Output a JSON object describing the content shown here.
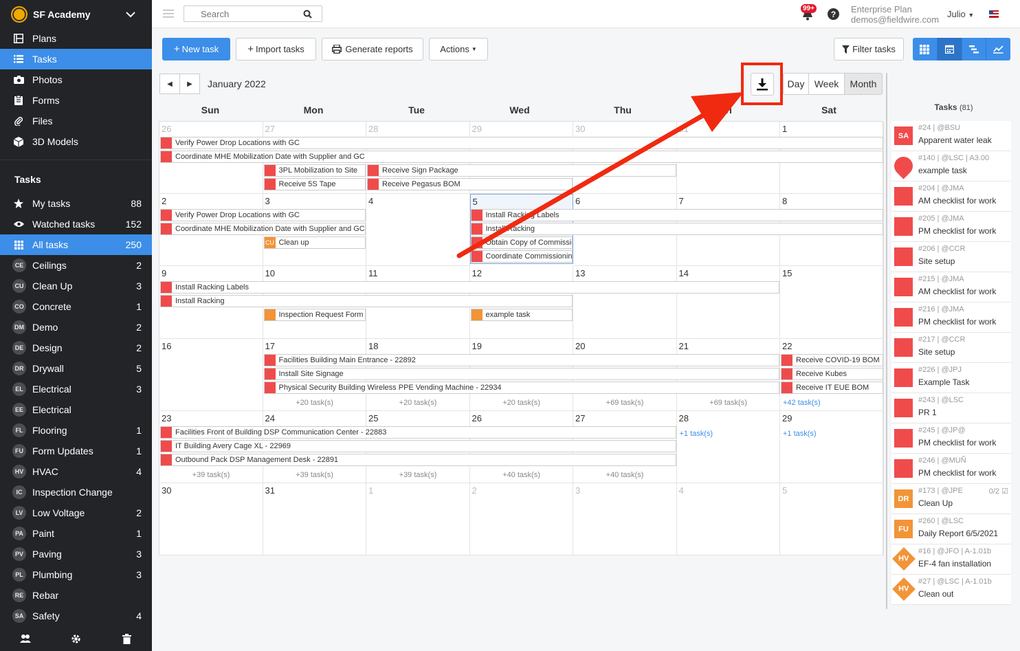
{
  "sidebar": {
    "project": "SF Academy",
    "nav": [
      {
        "label": "Plans",
        "icon": "plans-icon"
      },
      {
        "label": "Tasks",
        "icon": "tasks-icon"
      },
      {
        "label": "Photos",
        "icon": "camera-icon"
      },
      {
        "label": "Forms",
        "icon": "forms-icon"
      },
      {
        "label": "Files",
        "icon": "paperclip-icon"
      },
      {
        "label": "3D Models",
        "icon": "cube-icon"
      }
    ],
    "section_title": "Tasks",
    "filters": [
      {
        "label": "My tasks",
        "count": "88"
      },
      {
        "label": "Watched tasks",
        "count": "152"
      },
      {
        "label": "All tasks",
        "count": "250"
      }
    ],
    "categories": [
      {
        "abbr": "CE",
        "label": "Ceilings",
        "count": "2"
      },
      {
        "abbr": "CU",
        "label": "Clean Up",
        "count": "3"
      },
      {
        "abbr": "CO",
        "label": "Concrete",
        "count": "1"
      },
      {
        "abbr": "DM",
        "label": "Demo",
        "count": "2"
      },
      {
        "abbr": "DE",
        "label": "Design",
        "count": "2"
      },
      {
        "abbr": "DR",
        "label": "Drywall",
        "count": "5"
      },
      {
        "abbr": "EL",
        "label": "Electrical",
        "count": "3"
      },
      {
        "abbr": "EE",
        "label": "Electrical",
        "count": ""
      },
      {
        "abbr": "FL",
        "label": "Flooring",
        "count": "1"
      },
      {
        "abbr": "FU",
        "label": "Form Updates",
        "count": "1"
      },
      {
        "abbr": "HV",
        "label": "HVAC",
        "count": "4"
      },
      {
        "abbr": "IC",
        "label": "Inspection Change",
        "count": ""
      },
      {
        "abbr": "LV",
        "label": "Low Voltage",
        "count": "2"
      },
      {
        "abbr": "PA",
        "label": "Paint",
        "count": "1"
      },
      {
        "abbr": "PV",
        "label": "Paving",
        "count": "3"
      },
      {
        "abbr": "PL",
        "label": "Plumbing",
        "count": "3"
      },
      {
        "abbr": "RE",
        "label": "Rebar",
        "count": ""
      },
      {
        "abbr": "SA",
        "label": "Safety",
        "count": "4"
      }
    ]
  },
  "topbar": {
    "search_placeholder": "Search",
    "notif_badge": "99+",
    "help": "?",
    "plan_name": "Enterprise Plan",
    "plan_email": "demos@fieldwire.com",
    "user": "Julio"
  },
  "toolbar": {
    "new_task": "New task",
    "import_tasks": "Import tasks",
    "generate_reports": "Generate reports",
    "actions": "Actions",
    "filter_tasks": "Filter tasks"
  },
  "calendar": {
    "title": "January 2022",
    "views": [
      "Day",
      "Week",
      "Month"
    ],
    "selected_view": "Month",
    "weekdays": [
      "Sun",
      "Mon",
      "Tue",
      "Wed",
      "Thu",
      "Fri",
      "Sat"
    ],
    "weeks": [
      [
        "26",
        "27",
        "28",
        "29",
        "30",
        "31",
        "1"
      ],
      [
        "2",
        "3",
        "4",
        "5",
        "6",
        "7",
        "8"
      ],
      [
        "9",
        "10",
        "11",
        "12",
        "13",
        "14",
        "15"
      ],
      [
        "16",
        "17",
        "18",
        "19",
        "20",
        "21",
        "22"
      ],
      [
        "23",
        "24",
        "25",
        "26",
        "27",
        "28",
        "29"
      ],
      [
        "30",
        "31",
        "1",
        "2",
        "3",
        "4",
        "5"
      ]
    ],
    "dim": [
      [
        1,
        1,
        1,
        1,
        1,
        1,
        0
      ],
      [
        0,
        0,
        0,
        0,
        0,
        0,
        0
      ],
      [
        0,
        0,
        0,
        0,
        0,
        0,
        0
      ],
      [
        0,
        0,
        0,
        0,
        0,
        0,
        0
      ],
      [
        0,
        0,
        0,
        0,
        0,
        0,
        0
      ],
      [
        0,
        0,
        1,
        1,
        1,
        1,
        1
      ]
    ],
    "today": [
      1,
      3
    ],
    "events": [
      {
        "w": 0,
        "s": 0,
        "e": 6,
        "row": 0,
        "label": "Verify Power Drop Locations with GC",
        "color": "red"
      },
      {
        "w": 0,
        "s": 0,
        "e": 6,
        "row": 1,
        "label": "Coordinate MHE Mobilization Date with Supplier and GC",
        "color": "red"
      },
      {
        "w": 0,
        "s": 1,
        "e": 1,
        "row": 2,
        "label": "3PL Mobilization to Site",
        "color": "red"
      },
      {
        "w": 0,
        "s": 2,
        "e": 4,
        "row": 2,
        "label": "Receive Sign Package",
        "color": "red"
      },
      {
        "w": 0,
        "s": 1,
        "e": 1,
        "row": 3,
        "label": "Receive 5S Tape",
        "color": "red"
      },
      {
        "w": 0,
        "s": 2,
        "e": 3,
        "row": 3,
        "label": "Receive Pegasus BOM",
        "color": "red"
      },
      {
        "w": 1,
        "s": 0,
        "e": 1,
        "row": 0,
        "label": "Verify Power Drop Locations with GC",
        "color": "red"
      },
      {
        "w": 1,
        "s": 0,
        "e": 1,
        "row": 1,
        "label": "Coordinate MHE Mobilization Date with Supplier and GC",
        "color": "red"
      },
      {
        "w": 1,
        "s": 1,
        "e": 1,
        "row": 2,
        "label": "Clean up",
        "color": "orange",
        "abbr": "CU"
      },
      {
        "w": 1,
        "s": 3,
        "e": 6,
        "row": 0,
        "label": "Install Racking Labels",
        "color": "red"
      },
      {
        "w": 1,
        "s": 3,
        "e": 6,
        "row": 1,
        "label": "Install Racking",
        "color": "red"
      },
      {
        "w": 1,
        "s": 3,
        "e": 3,
        "row": 2,
        "label": "Obtain Copy of Commissioning",
        "color": "red"
      },
      {
        "w": 1,
        "s": 3,
        "e": 3,
        "row": 3,
        "label": "Coordinate Commissioning",
        "color": "red"
      },
      {
        "w": 2,
        "s": 0,
        "e": 5,
        "row": 0,
        "label": "Install Racking Labels",
        "color": "red"
      },
      {
        "w": 2,
        "s": 0,
        "e": 3,
        "row": 1,
        "label": "Install Racking",
        "color": "red"
      },
      {
        "w": 2,
        "s": 1,
        "e": 1,
        "row": 2,
        "label": "Inspection Request Form",
        "color": "orange"
      },
      {
        "w": 2,
        "s": 3,
        "e": 3,
        "row": 2,
        "label": "example task",
        "color": "orange"
      },
      {
        "w": 3,
        "s": 1,
        "e": 5,
        "row": 0,
        "label": "Facilities Building Main Entrance - 22892",
        "color": "red"
      },
      {
        "w": 3,
        "s": 1,
        "e": 5,
        "row": 1,
        "label": "Install Site Signage",
        "color": "red"
      },
      {
        "w": 3,
        "s": 1,
        "e": 5,
        "row": 2,
        "label": "Physical Security Building Wireless PPE Vending Machine - 22934",
        "color": "red"
      },
      {
        "w": 3,
        "s": 6,
        "e": 6,
        "row": 0,
        "label": "Receive COVID-19 BOM",
        "color": "red"
      },
      {
        "w": 3,
        "s": 6,
        "e": 6,
        "row": 1,
        "label": "Receive Kubes",
        "color": "red"
      },
      {
        "w": 3,
        "s": 6,
        "e": 6,
        "row": 2,
        "label": "Receive IT EUE BOM",
        "color": "red"
      },
      {
        "w": 4,
        "s": 0,
        "e": 4,
        "row": 0,
        "label": "Facilities Front of Building DSP Communication Center - 22883",
        "color": "red"
      },
      {
        "w": 4,
        "s": 0,
        "e": 4,
        "row": 1,
        "label": "IT Building Avery Cage XL - 22969",
        "color": "red"
      },
      {
        "w": 4,
        "s": 0,
        "e": 4,
        "row": 2,
        "label": "Outbound Pack DSP Management Desk - 22891",
        "color": "red"
      }
    ],
    "more": [
      {
        "w": 3,
        "d": 1,
        "label": "+20 task(s)"
      },
      {
        "w": 3,
        "d": 2,
        "label": "+20 task(s)"
      },
      {
        "w": 3,
        "d": 3,
        "label": "+20 task(s)"
      },
      {
        "w": 3,
        "d": 4,
        "label": "+69 task(s)"
      },
      {
        "w": 3,
        "d": 5,
        "label": "+69 task(s)"
      },
      {
        "w": 3,
        "d": 6,
        "label": "+42 task(s)",
        "blue": true
      },
      {
        "w": 4,
        "d": 0,
        "label": "+39 task(s)"
      },
      {
        "w": 4,
        "d": 1,
        "label": "+39 task(s)"
      },
      {
        "w": 4,
        "d": 2,
        "label": "+39 task(s)"
      },
      {
        "w": 4,
        "d": 3,
        "label": "+40 task(s)"
      },
      {
        "w": 4,
        "d": 4,
        "label": "+40 task(s)"
      },
      {
        "w": 4,
        "d": 5,
        "label": "+1 task(s)",
        "blue": true,
        "top": true
      },
      {
        "w": 4,
        "d": 6,
        "label": "+1 task(s)",
        "blue": true,
        "top": true
      }
    ]
  },
  "task_list": {
    "title": "Tasks",
    "count": "(81)",
    "items": [
      {
        "meta": "#24 | @BSU",
        "name": "Apparent water leak",
        "badge": "SA",
        "style": "sq",
        "color": "red"
      },
      {
        "meta": "#140 | @LSC | A3.00",
        "name": "example task",
        "badge": "",
        "style": "pin",
        "color": "red"
      },
      {
        "meta": "#204 | @JMA",
        "name": "AM checklist for work",
        "badge": "",
        "style": "sq",
        "color": "red"
      },
      {
        "meta": "#205 | @JMA",
        "name": "PM checklist for work",
        "badge": "",
        "style": "sq",
        "color": "red"
      },
      {
        "meta": "#206 | @CCR",
        "name": "Site setup",
        "badge": "",
        "style": "sq",
        "color": "red"
      },
      {
        "meta": "#215 | @JMA",
        "name": "AM checklist for work",
        "badge": "",
        "style": "sq",
        "color": "red"
      },
      {
        "meta": "#216 | @JMA",
        "name": "PM checklist for work",
        "badge": "",
        "style": "sq",
        "color": "red"
      },
      {
        "meta": "#217 | @CCR",
        "name": "Site setup",
        "badge": "",
        "style": "sq",
        "color": "red"
      },
      {
        "meta": "#226 | @JPJ",
        "name": "Example Task",
        "badge": "",
        "style": "sq",
        "color": "red"
      },
      {
        "meta": "#243 | @LSC",
        "name": "PR 1",
        "badge": "",
        "style": "sq",
        "color": "red"
      },
      {
        "meta": "#245 | @JP@",
        "name": "PM checklist for work",
        "badge": "",
        "style": "sq",
        "color": "red"
      },
      {
        "meta": "#246 | @MUÑ",
        "name": "PM checklist for work",
        "badge": "",
        "style": "sq",
        "color": "red"
      },
      {
        "meta": "#173 | @JPE",
        "name": "Clean Up",
        "badge": "DR",
        "style": "sq",
        "color": "orange",
        "progress": "0/2"
      },
      {
        "meta": "#260 | @LSC",
        "name": "Daily Report 6/5/2021",
        "badge": "FU",
        "style": "sq",
        "color": "orange"
      },
      {
        "meta": "#16 | @JFO | A-1.01b",
        "name": "EF-4 fan installation",
        "badge": "HV",
        "style": "dia",
        "color": "orange"
      },
      {
        "meta": "#27 | @LSC | A-1.01b",
        "name": "Clean out",
        "badge": "HV",
        "style": "dia",
        "color": "orange"
      }
    ]
  },
  "colors": {
    "accent": "#3c8ee8",
    "task_red": "#f04b4b",
    "task_orange": "#f29438",
    "annotation_red": "#f02a10"
  }
}
